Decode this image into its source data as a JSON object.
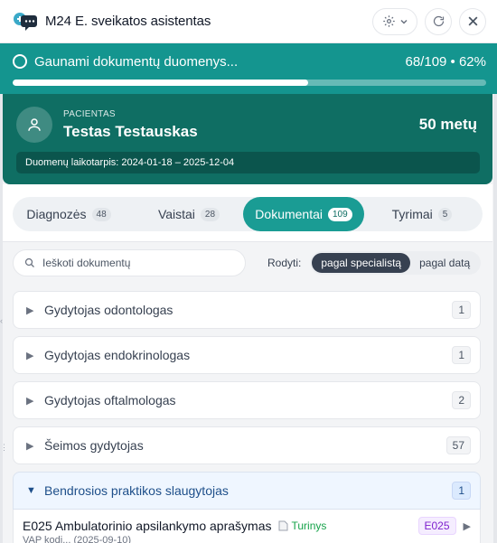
{
  "app": {
    "title": "M24 E. sveikatos asistentas"
  },
  "progress": {
    "text": "Gaunami dokumentų duomenys...",
    "count": "68/109 • 62%",
    "value": 0.6239
  },
  "patient": {
    "label": "PACIENTAS",
    "name": "Testas Testauskas",
    "age": "50 metų",
    "period": "Duomenų laikotarpis: 2024-01-18 – 2025-12-04"
  },
  "tabs": [
    {
      "label": "Diagnozės",
      "count": "48"
    },
    {
      "label": "Vaistai",
      "count": "28"
    },
    {
      "label": "Dokumentai",
      "count": "109"
    },
    {
      "label": "Tyrimai",
      "count": "5"
    }
  ],
  "search": {
    "placeholder": "Ieškoti dokumentų"
  },
  "view": {
    "label": "Rodyti:",
    "options": [
      "pagal specialistą",
      "pagal datą"
    ]
  },
  "groups": [
    {
      "name": "Gydytojas odontologas",
      "count": "1"
    },
    {
      "name": "Gydytojas endokrinologas",
      "count": "1"
    },
    {
      "name": "Gydytojas oftalmologas",
      "count": "2"
    },
    {
      "name": "Šeimos gydytojas",
      "count": "57"
    },
    {
      "name": "Bendrosios praktikos slaugytojas",
      "count": "1"
    }
  ],
  "document": {
    "title": "E025 Ambulatorinio apsilankymo aprašymas",
    "content_label": "Turinys",
    "badge": "E025",
    "subtitle": "VAP kodi... (2025-09-10)"
  },
  "colors": {
    "accent": "#1a9c94",
    "header": "#0f6e63",
    "progress": "#14958f"
  },
  "icons": {
    "logo": "chat-medical-icon",
    "settings": "gear-icon",
    "refresh": "refresh-icon",
    "close": "close-icon",
    "avatar": "user-icon",
    "search": "search-icon",
    "file": "file-icon"
  }
}
